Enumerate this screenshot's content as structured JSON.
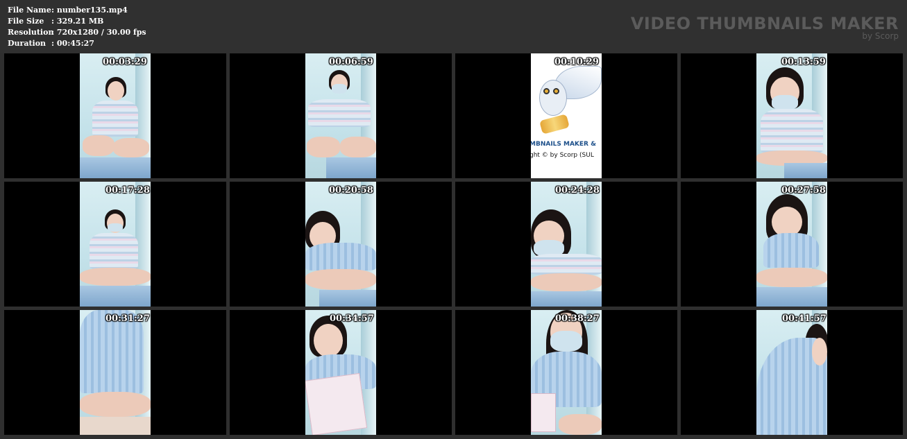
{
  "info": {
    "rows": [
      {
        "label": "File Name",
        "value": ": number135.mp4"
      },
      {
        "label": "File Size",
        "value": ": 329.21 MB"
      },
      {
        "label": "Resolution",
        "value": ": 720x1280 / 30.00 fps"
      },
      {
        "label": "Duration",
        "value": ": 00:45:27"
      }
    ]
  },
  "brand": {
    "title": "VIDEO THUMBNAILS MAKER",
    "subtitle": "by Scorp"
  },
  "thumbnails": [
    {
      "time": "00:03:29"
    },
    {
      "time": "00:06:59"
    },
    {
      "time": "00:10:29",
      "overlay_line1": "MBNAILS MAKER &",
      "overlay_line2": "ght © by Scorp (SUL"
    },
    {
      "time": "00:13:59"
    },
    {
      "time": "00:17:28"
    },
    {
      "time": "00:20:58"
    },
    {
      "time": "00:24:28"
    },
    {
      "time": "00:27:58"
    },
    {
      "time": "00:31:27"
    },
    {
      "time": "00:34:57"
    },
    {
      "time": "00:38:27"
    },
    {
      "time": "00:41:57"
    }
  ],
  "colors": {
    "background": "#2f2f2f",
    "cell": "#000000",
    "brand_text": "#5b5b5b"
  }
}
